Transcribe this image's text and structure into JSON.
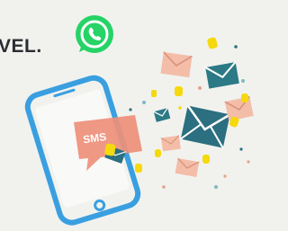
{
  "heading": {
    "text": "VEL."
  },
  "bubble": {
    "label": "SMS"
  },
  "icons": {
    "whatsapp": "whatsapp-icon",
    "phone": "smartphone-icon",
    "envelope": "envelope-icon",
    "coin": "coin-icon"
  },
  "colors": {
    "whatsapp_green": "#25d366",
    "phone_blue": "#3a9fe0",
    "sms_bubble": "#ee8f7a",
    "envelope_teal": "#2b6f80",
    "envelope_peach": "#f3bda8",
    "coin_yellow": "#f5d90c"
  }
}
